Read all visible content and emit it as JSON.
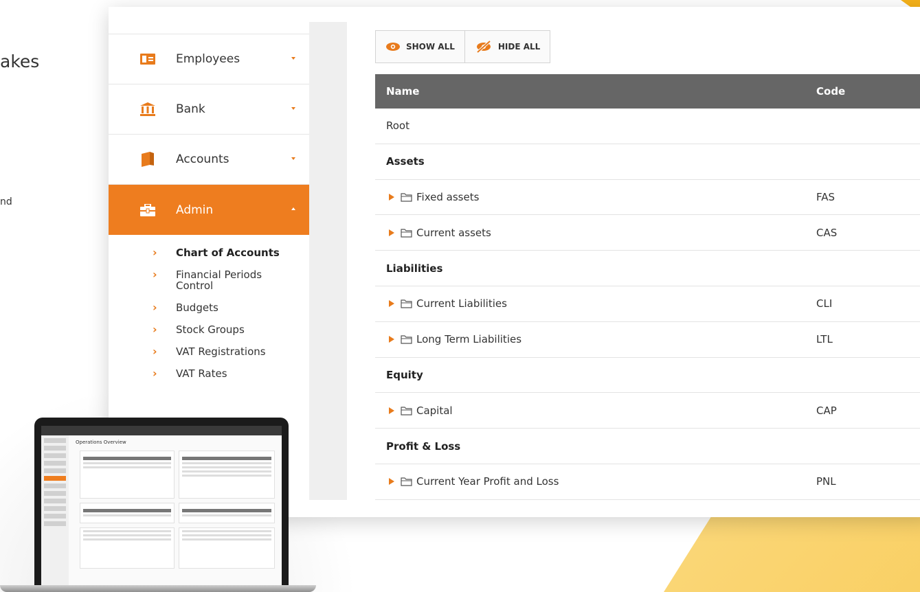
{
  "page": {
    "partial_heading": "akes",
    "partial_text": "nd"
  },
  "sidebar": {
    "items": [
      {
        "label": "Employees",
        "icon": "id-card-icon"
      },
      {
        "label": "Bank",
        "icon": "bank-icon"
      },
      {
        "label": "Accounts",
        "icon": "book-icon"
      },
      {
        "label": "Admin",
        "icon": "briefcase-icon",
        "active": true
      }
    ],
    "subitems": [
      {
        "label": "Chart of Accounts",
        "current": true
      },
      {
        "label": "Financial Periods Control"
      },
      {
        "label": "Budgets"
      },
      {
        "label": "Stock Groups"
      },
      {
        "label": "VAT Registrations"
      },
      {
        "label": "VAT Rates"
      }
    ]
  },
  "toolbar": {
    "show_all_label": "SHOW ALL",
    "hide_all_label": "HIDE ALL"
  },
  "table": {
    "headers": {
      "name": "Name",
      "code": "Code"
    },
    "rows": [
      {
        "type": "plain",
        "name": "Root",
        "code": ""
      },
      {
        "type": "group",
        "name": "Assets",
        "code": ""
      },
      {
        "type": "leaf",
        "name": "Fixed assets",
        "code": "FAS"
      },
      {
        "type": "leaf",
        "name": "Current assets",
        "code": "CAS"
      },
      {
        "type": "group",
        "name": "Liabilities",
        "code": ""
      },
      {
        "type": "leaf",
        "name": "Current Liabilities",
        "code": "CLI"
      },
      {
        "type": "leaf",
        "name": "Long Term Liabilities",
        "code": "LTL"
      },
      {
        "type": "group",
        "name": "Equity",
        "code": ""
      },
      {
        "type": "leaf",
        "name": "Capital",
        "code": "CAP"
      },
      {
        "type": "group",
        "name": "Profit & Loss",
        "code": ""
      },
      {
        "type": "leaf",
        "name": "Current Year Profit and Loss",
        "code": "PNL"
      }
    ]
  },
  "laptop": {
    "screen_title": "Operations Overview"
  },
  "colors": {
    "accent": "#ee7d1f",
    "header_bg": "#666666",
    "yellow": "#f9cf62"
  }
}
